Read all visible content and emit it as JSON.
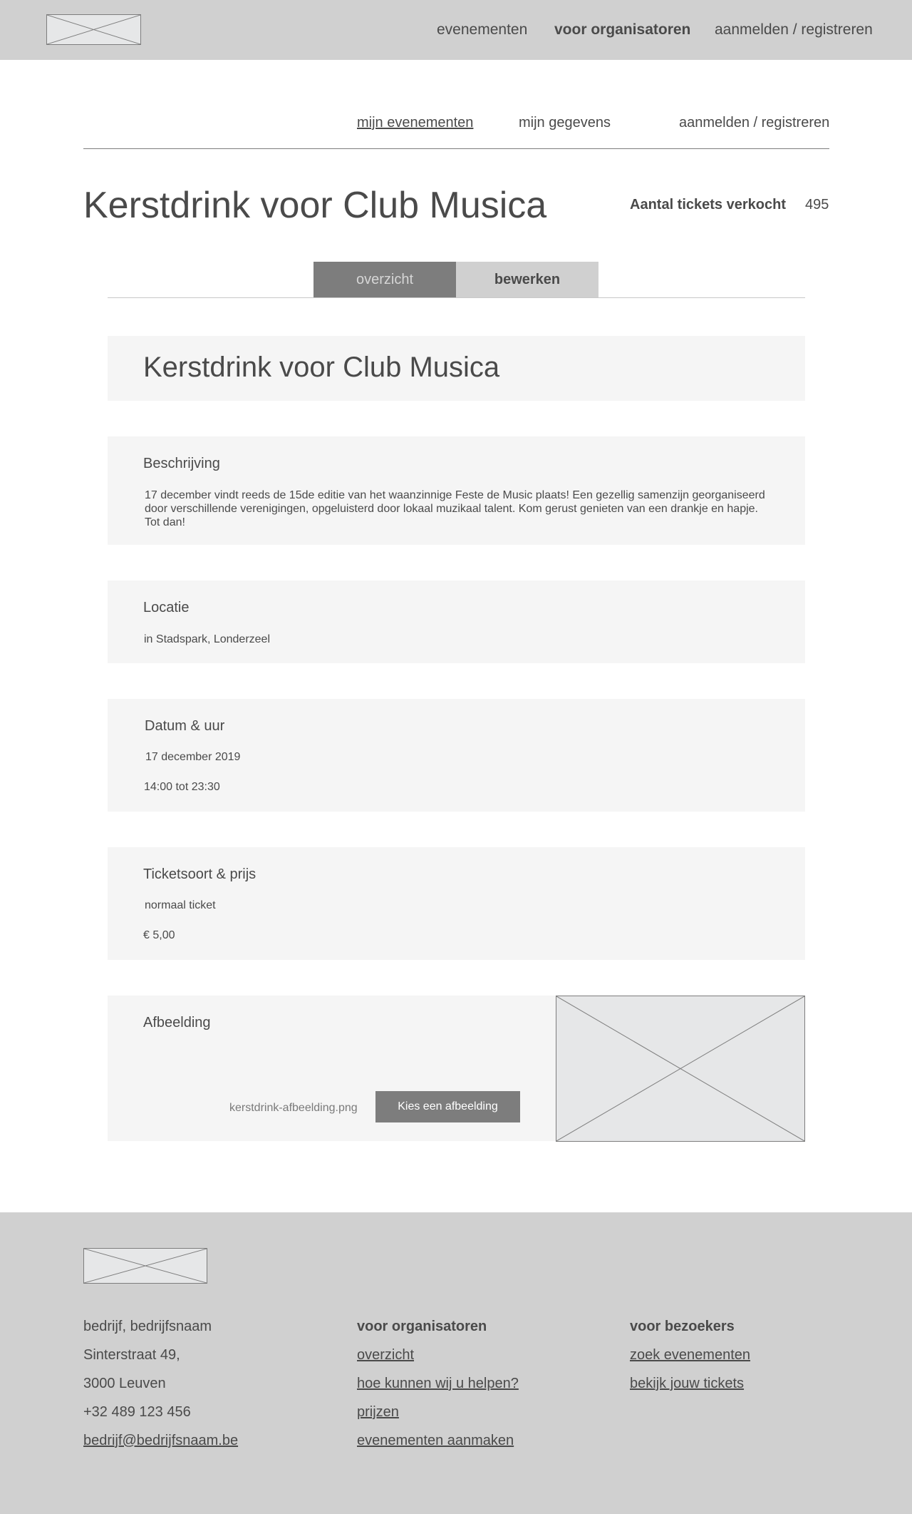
{
  "topnav": {
    "items": [
      "evenementen",
      "voor organisatoren",
      "aanmelden / registreren"
    ]
  },
  "subnav": {
    "items": [
      "mijn evenementen",
      "mijn gegevens",
      "aanmelden / registreren"
    ]
  },
  "page": {
    "title": "Kerstdrink voor Club Musica",
    "tickets_label": "Aantal tickets verkocht",
    "tickets_value": "495"
  },
  "tabs": [
    "overzicht",
    "bewerken"
  ],
  "event": {
    "title": "Kerstdrink voor Club Musica",
    "description": {
      "heading": "Beschrijving",
      "text": "17 december vindt reeds de 15de editie van het waanzinnige Feste de Music plaats! Een gezellig samenzijn georganiseerd door verschillende verenigingen, opgeluisterd door lokaal muzikaal talent. Kom gerust genieten van een drankje en hapje. Tot dan!"
    },
    "location": {
      "heading": "Locatie",
      "text": "in Stadspark, Londerzeel"
    },
    "datetime": {
      "heading": "Datum & uur",
      "date": "17 december 2019",
      "time": "14:00 tot 23:30"
    },
    "ticket": {
      "heading": "Ticketsoort & prijs",
      "type": "normaal ticket",
      "price": "€ 5,00"
    },
    "image": {
      "heading": "Afbeelding",
      "filename": "kerstdrink-afbeelding.png",
      "button": "Kies een afbeelding"
    }
  },
  "footer": {
    "company": [
      "bedrijf, bedrijfsnaam",
      "Sinterstraat 49,",
      "3000 Leuven",
      "+32 489 123 456",
      "bedrijf@bedrijfsnaam.be"
    ],
    "organizers": {
      "heading": "voor organisatoren",
      "links": [
        "overzicht",
        "hoe kunnen wij u helpen?",
        "prijzen",
        "evenementen aanmaken"
      ]
    },
    "visitors": {
      "heading": "voor bezoekers",
      "links": [
        "zoek evenementen",
        "bekijk jouw tickets"
      ]
    }
  },
  "colors": {
    "bar_gray": "#d0d0d0",
    "card_bg": "#f5f5f5",
    "button_dark": "#7d7d7d",
    "text": "#4a4a4a"
  }
}
